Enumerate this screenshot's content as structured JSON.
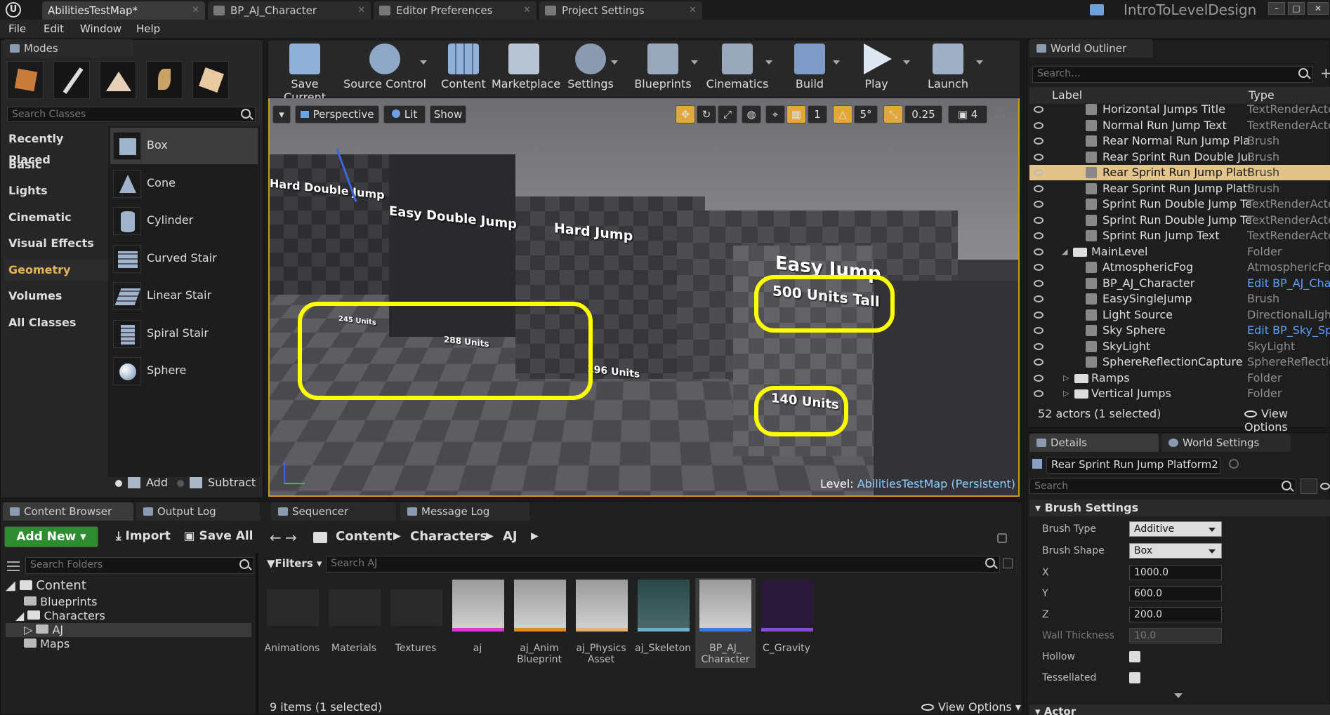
{
  "titlebar": {
    "tabs": [
      "AbilitiesTestMap*",
      "BP_AJ_Character",
      "Editor Preferences",
      "Project Settings"
    ],
    "project": "IntroToLevelDesign"
  },
  "menu": [
    "File",
    "Edit",
    "Window",
    "Help"
  ],
  "modes": {
    "title": "Modes",
    "search_placeholder": "Search Classes",
    "categories": [
      "Recently Placed",
      "Basic",
      "Lights",
      "Cinematic",
      "Visual Effects",
      "Geometry",
      "Volumes",
      "All Classes"
    ],
    "items": [
      "Box",
      "Cone",
      "Cylinder",
      "Curved Stair",
      "Linear Stair",
      "Spiral Stair",
      "Sphere"
    ],
    "add": "Add",
    "subtract": "Subtract"
  },
  "toolbar": [
    "Save Current",
    "Source Control",
    "Content",
    "Marketplace",
    "Settings",
    "Blueprints",
    "Cinematics",
    "Build",
    "Play",
    "Launch"
  ],
  "viewport": {
    "perspective": "Perspective",
    "lit": "Lit",
    "show": "Show",
    "grid_snap": "1",
    "rot_snap": "5°",
    "scale_snap": "0.25",
    "cam_speed": "4",
    "level_label": "Level:",
    "level_name": "AbilitiesTestMap (Persistent)",
    "labels": [
      "Hard Double Jump",
      "Easy Double Jump",
      "Hard Jump",
      "Easy Jump",
      "500 Units Tall",
      "245 Units",
      "288 Units",
      "196 Units",
      "140 Units"
    ]
  },
  "outliner": {
    "title": "World Outliner",
    "search_placeholder": "Search...",
    "col_label": "Label",
    "col_type": "Type",
    "rows": [
      {
        "name": "Horizontal Jumps Title",
        "type": "TextRenderActor"
      },
      {
        "name": "Normal Run Jump Text",
        "type": "TextRenderActor"
      },
      {
        "name": "Rear Normal Run Jump Platfo",
        "type": "Brush"
      },
      {
        "name": "Rear Sprint Run Double Jump",
        "type": "Brush"
      },
      {
        "name": "Rear Sprint Run Jump Platfor",
        "type": "Brush"
      },
      {
        "name": "Rear Sprint Run Jump Platfor",
        "type": "Brush"
      },
      {
        "name": "Sprint Run Double Jump Text",
        "type": "TextRenderActor"
      },
      {
        "name": "Sprint Run Double Jump Text",
        "type": "TextRenderActor"
      },
      {
        "name": "Sprint Run Jump Text",
        "type": "TextRenderActor"
      },
      {
        "name": "MainLevel",
        "type": "Folder"
      },
      {
        "name": "AtmosphericFog",
        "type": "AtmosphericFog"
      },
      {
        "name": "BP_AJ_Character",
        "type": "Edit BP_AJ_Cha"
      },
      {
        "name": "EasySingleJump",
        "type": "Brush"
      },
      {
        "name": "Light Source",
        "type": "DirectionalLight"
      },
      {
        "name": "Sky Sphere",
        "type": "Edit BP_Sky_Sp"
      },
      {
        "name": "SkyLight",
        "type": "SkyLight"
      },
      {
        "name": "SphereReflectionCapture",
        "type": "SphereReflectior"
      },
      {
        "name": "Ramps",
        "type": "Folder"
      },
      {
        "name": "Vertical Jumps",
        "type": "Folder"
      }
    ],
    "status": "52 actors (1 selected)",
    "view_options": "View Options"
  },
  "details": {
    "tab_details": "Details",
    "tab_world": "World Settings",
    "object_name": "Rear Sprint Run Jump Platform2",
    "search_placeholder": "Search",
    "section": "Brush Settings",
    "brush_type_label": "Brush Type",
    "brush_type": "Additive",
    "brush_shape_label": "Brush Shape",
    "brush_shape": "Box",
    "x_label": "X",
    "x": "1000.0",
    "y_label": "Y",
    "y": "600.0",
    "z_label": "Z",
    "z": "200.0",
    "wall_label": "Wall Thickness",
    "wall": "10.0",
    "hollow_label": "Hollow",
    "tess_label": "Tessellated",
    "actor_section": "Actor"
  },
  "bottom_tabs": [
    "Content Browser",
    "Output Log",
    "Sequencer",
    "Message Log"
  ],
  "content": {
    "add_new": "Add New",
    "import": "Import",
    "save_all": "Save All",
    "path": [
      "Content",
      "Characters",
      "AJ"
    ],
    "search_folders": "Search Folders",
    "filters": "Filters",
    "search_assets": "Search AJ",
    "tree": [
      "Content",
      "Blueprints",
      "Characters",
      "AJ",
      "Maps"
    ],
    "assets": [
      "Animations",
      "Materials",
      "Textures",
      "aj",
      "aj_Anim Blueprint",
      "aj_Physics Asset",
      "aj_Skeleton",
      "BP_AJ_ Character",
      "C_Gravity"
    ],
    "status": "9 items (1 selected)",
    "view_options": "View Options"
  }
}
